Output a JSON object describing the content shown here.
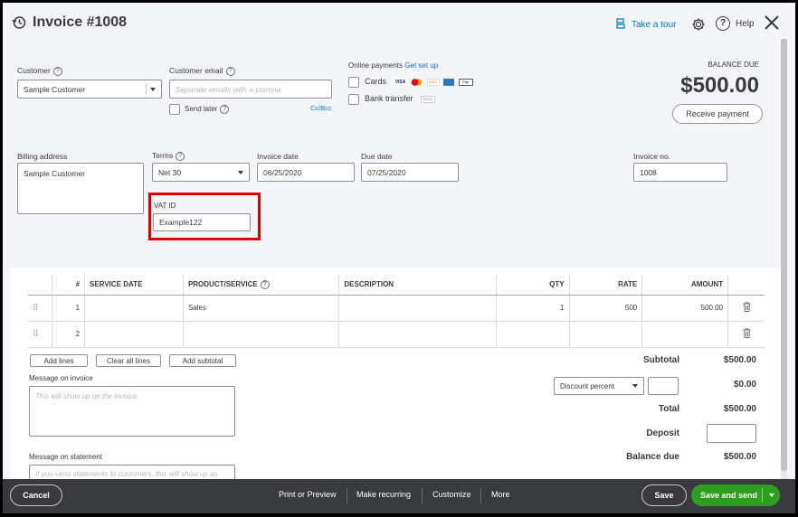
{
  "header": {
    "title": "Invoice #1008",
    "take_tour": "Take a tour",
    "help": "Help"
  },
  "customer": {
    "label": "Customer",
    "value": "Sample Customer",
    "email_label": "Customer email",
    "email_placeholder": "Separate emails with a comma",
    "send_later": "Send later",
    "cc_bcc": "Cc/Bcc"
  },
  "online_payments": {
    "label": "Online payments",
    "setup_link": "Get set up",
    "cards": "Cards",
    "bank_transfer": "Bank transfer",
    "card_icons": [
      "VISA",
      "MC",
      "DISC",
      "AMEX",
      "Apple Pay"
    ],
    "bank_icon": "BANK"
  },
  "balance": {
    "label": "BALANCE DUE",
    "amount": "$500.00",
    "receive_payment": "Receive payment"
  },
  "billing": {
    "address_label": "Billing address",
    "address_value": "Sample Customer",
    "terms_label": "Terms",
    "terms_value": "Net 30",
    "invoice_date_label": "Invoice date",
    "invoice_date_value": "06/25/2020",
    "due_date_label": "Due date",
    "due_date_value": "07/25/2020",
    "invoice_no_label": "Invoice no.",
    "invoice_no_value": "1008",
    "vat_label": "VAT ID",
    "vat_value": "Example122"
  },
  "table": {
    "headers": [
      "#",
      "SERVICE DATE",
      "PRODUCT/SERVICE",
      "DESCRIPTION",
      "QTY",
      "RATE",
      "AMOUNT"
    ],
    "rows": [
      {
        "num": "1",
        "date": "",
        "product": "Sales",
        "description": "",
        "qty": "1",
        "rate": "500",
        "amount": "500.00"
      },
      {
        "num": "2",
        "date": "",
        "product": "",
        "description": "",
        "qty": "",
        "rate": "",
        "amount": ""
      }
    ]
  },
  "line_buttons": {
    "add_lines": "Add lines",
    "clear_all": "Clear all lines",
    "add_subtotal": "Add subtotal"
  },
  "messages": {
    "invoice_label": "Message on invoice",
    "invoice_placeholder": "This will show up on the invoice.",
    "statement_label": "Message on statement",
    "statement_placeholder": "If you send statements to customers, this will show up as"
  },
  "totals": {
    "subtotal_label": "Subtotal",
    "subtotal_value": "$500.00",
    "discount_select": "Discount percent",
    "discount_value": "$0.00",
    "total_label": "Total",
    "total_value": "$500.00",
    "deposit_label": "Deposit",
    "balance_due_label": "Balance due",
    "balance_due_value": "$500.00"
  },
  "footer": {
    "cancel": "Cancel",
    "print_preview": "Print or Preview",
    "make_recurring": "Make recurring",
    "customize": "Customize",
    "more": "More",
    "save": "Save",
    "save_send": "Save and send"
  },
  "colors": {
    "brand_green": "#2ca01c",
    "link_blue": "#0077c5",
    "highlight_red": "#e00000",
    "footer_bg": "#393a3d"
  }
}
